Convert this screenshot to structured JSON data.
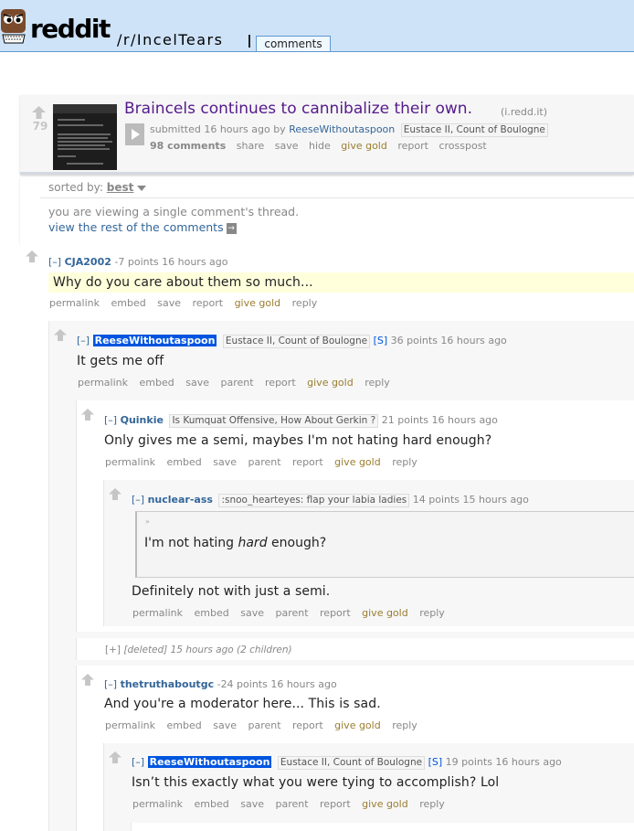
{
  "header": {
    "wordmark": "reddit",
    "subreddit": "/r/IncelTears",
    "active_tab": "comments"
  },
  "post": {
    "score": "79",
    "title": "Braincels continues to cannibalize their own.",
    "domain": "(i.redd.it)",
    "submitted_prefix": "submitted 16 hours ago by",
    "author": "ReeseWithoutaspoon",
    "author_flair": "Eustace II, Count of Boulogne",
    "buttons": {
      "comments": "98 comments",
      "share": "share",
      "save": "save",
      "hide": "hide",
      "give_gold": "give gold",
      "report": "report",
      "crosspost": "crosspost"
    }
  },
  "sort": {
    "label": "sorted by:",
    "value": "best"
  },
  "notice": {
    "text": "you are viewing a single comment's thread.",
    "link": "view the rest of the comments",
    "arrow": "→"
  },
  "comments": [
    {
      "toggle": "[–]",
      "author": "CJA2002",
      "meta": "-7 points 16 hours ago",
      "body": "Why do you care about them so much...",
      "buttons": [
        "permalink",
        "embed",
        "save",
        "report",
        "give gold",
        "reply"
      ]
    },
    {
      "toggle": "[–]",
      "author": "ReeseWithoutaspoon",
      "flair": "Eustace II, Count of Boulogne",
      "submitter": "[S]",
      "meta": "36 points 16 hours ago",
      "body": "It gets me off",
      "buttons": [
        "permalink",
        "embed",
        "save",
        "parent",
        "report",
        "give gold",
        "reply"
      ]
    },
    {
      "toggle": "[–]",
      "author": "Quinkie",
      "flair": "Is Kumquat Offensive, How About Gerkin ?",
      "meta": "21 points 16 hours ago",
      "body": "Only gives me a semi, maybes I'm not hating hard enough?",
      "buttons": [
        "permalink",
        "embed",
        "save",
        "parent",
        "report",
        "give gold",
        "reply"
      ]
    },
    {
      "toggle": "[–]",
      "author": "nuclear-ass",
      "flair": ":snoo_hearteyes: flap your labia ladies",
      "meta": "14 points 15 hours ago",
      "quote_before": "I'm not hating ",
      "quote_em": "hard",
      "quote_after": " enough?",
      "body": "Definitely not with just a semi.",
      "buttons": [
        "permalink",
        "embed",
        "save",
        "parent",
        "report",
        "give gold",
        "reply"
      ]
    },
    {
      "toggle": "[+]",
      "deleted_text": "[deleted] 15 hours ago (2 children)"
    },
    {
      "toggle": "[–]",
      "author": "thetruthaboutgc",
      "meta": "-24 points 16 hours ago",
      "body": "And you're a moderator here... This is sad.",
      "buttons": [
        "permalink",
        "embed",
        "save",
        "parent",
        "report",
        "give gold",
        "reply"
      ]
    },
    {
      "toggle": "[–]",
      "author": "ReeseWithoutaspoon",
      "flair": "Eustace II, Count of Boulogne",
      "submitter": "[S]",
      "meta": "19 points 16 hours ago",
      "body": "Isn’t this exactly what you were tying to accomplish? Lol",
      "buttons": [
        "permalink",
        "embed",
        "save",
        "parent",
        "report",
        "give gold",
        "reply"
      ]
    }
  ],
  "colors": {
    "header_bg": "#cee3f8",
    "link_title": "#551a8b",
    "author": "#336699",
    "op_badge": "#0055df",
    "gold": "#9a7d2e",
    "highlight": "#ffffdc"
  }
}
